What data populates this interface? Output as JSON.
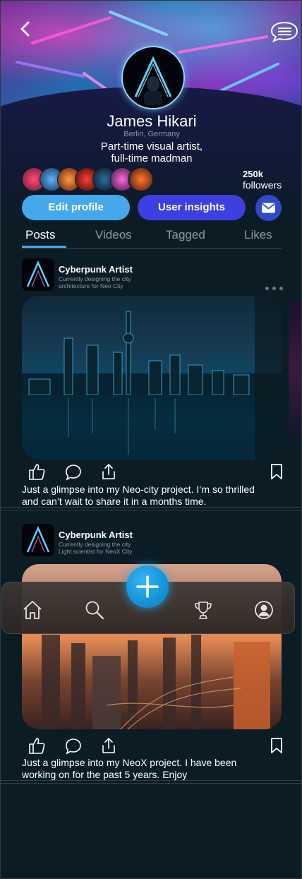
{
  "profile": {
    "name": "James Hikari",
    "location": "Berlin, Germany",
    "bio_line1": "Part-time visual artist,",
    "bio_line2": "full-time madman",
    "followers_count": "250k",
    "followers_label": "followers"
  },
  "header": {
    "back_icon": "chevron-left-icon",
    "chat_icon": "chat-bubble-icon"
  },
  "actions": {
    "edit_label": "Edit profile",
    "insights_label": "User insights",
    "mail_icon": "mail-icon",
    "colors": {
      "edit": "#45a8ea",
      "insights": "#3e3fe0",
      "mail": "#3149c5"
    }
  },
  "tabs": [
    {
      "label": "Posts",
      "active": true
    },
    {
      "label": "Videos",
      "active": false
    },
    {
      "label": "Tagged",
      "active": false
    },
    {
      "label": "Likes",
      "active": false
    }
  ],
  "posts": [
    {
      "author": "Cyberpunk Artist",
      "subtitle_line1": "Currently designing the city",
      "subtitle_line2": "architecture for Neo City",
      "caption_line1": "Just a glimpse into my Neo-city project. I’m so thrilled",
      "caption_line2": "and can’t wait to share it in a months time."
    },
    {
      "author": "Cyberpunk Artist",
      "subtitle_line1": "Currently designing the city",
      "subtitle_line2": "Light scientist for NeoX City",
      "caption_line1": "Just a glimpse into my NeoX project. I have been",
      "caption_line2": "working on for the past 5 years. Enjoy"
    }
  ],
  "bottom_nav": {
    "items": [
      "home-icon",
      "search-icon",
      "plus-icon",
      "trophy-icon",
      "profile-icon"
    ],
    "accent": "#1592d8"
  }
}
